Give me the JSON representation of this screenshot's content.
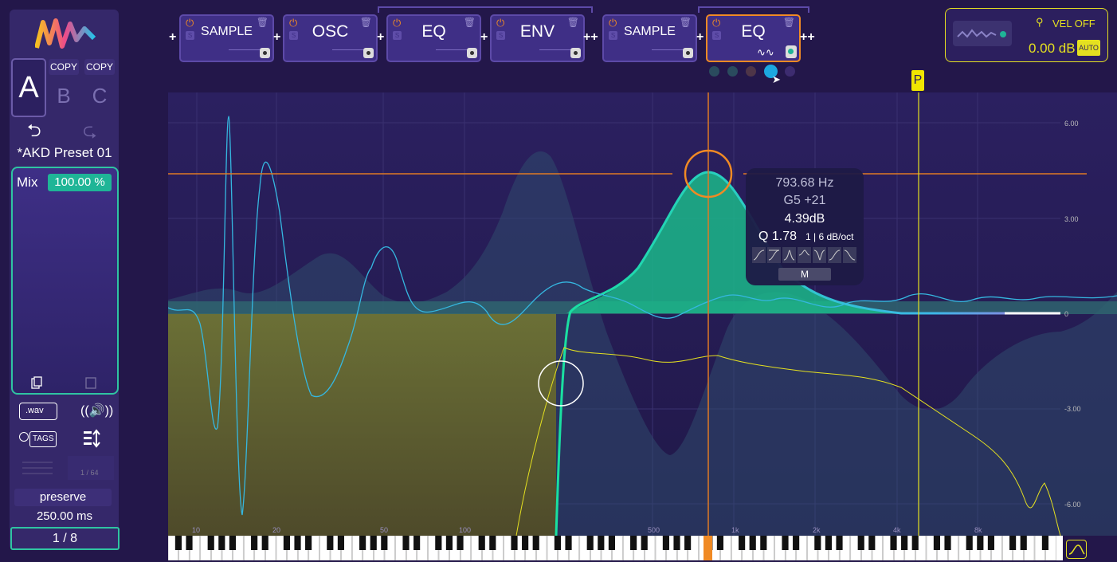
{
  "sidebar": {
    "slots": {
      "a": "A",
      "b": "B",
      "c": "C",
      "copy_b": "COPY",
      "copy_c": "COPY"
    },
    "undo_icon": "undo-icon",
    "redo_icon": "redo-icon",
    "preset_name": "*AKD Preset 01",
    "mix_label": "Mix",
    "mix_value": "100.00 %",
    "wav_label": ".wav",
    "tags_label": "TAGS",
    "map_value": "1 / 64",
    "preserve_label": "preserve",
    "time_value": "250.00 ms",
    "page_indicator": "1 / 8"
  },
  "modules": [
    {
      "title": "SAMPLE",
      "selected": false
    },
    {
      "title": "OSC",
      "selected": false
    },
    {
      "title": "EQ",
      "selected": false
    },
    {
      "title": "ENV",
      "selected": false
    },
    {
      "title": "SAMPLE",
      "selected": false
    },
    {
      "title": "EQ",
      "selected": true
    }
  ],
  "module_separators": {
    "plus": "+",
    "double_plus": "++"
  },
  "velocity": {
    "label": "VEL OFF",
    "value": "0.00 dB",
    "auto_label": "AUTO"
  },
  "colors": {
    "background": "#23174a",
    "accent_orange": "#f08a24",
    "accent_teal": "#1fb597",
    "curve_green": "#19c78f",
    "analyzer_yellow": "#e4e020",
    "curve_cyan": "#35b7e0"
  },
  "graph": {
    "db_labels": [
      "6.00",
      "3.00",
      "0",
      "-3.00",
      "-6.00"
    ],
    "freq_labels": [
      "10",
      "20",
      "50",
      "100",
      "500",
      "1k",
      "2k",
      "4k",
      "8k"
    ],
    "p_marker": "P"
  },
  "tooltip": {
    "frequency": "793.68 Hz",
    "note": "G5 +21",
    "gain": "4.39dB",
    "q_label": "Q 1.78",
    "slope": "1 | 6 dB/oct",
    "mode_button": "M"
  }
}
